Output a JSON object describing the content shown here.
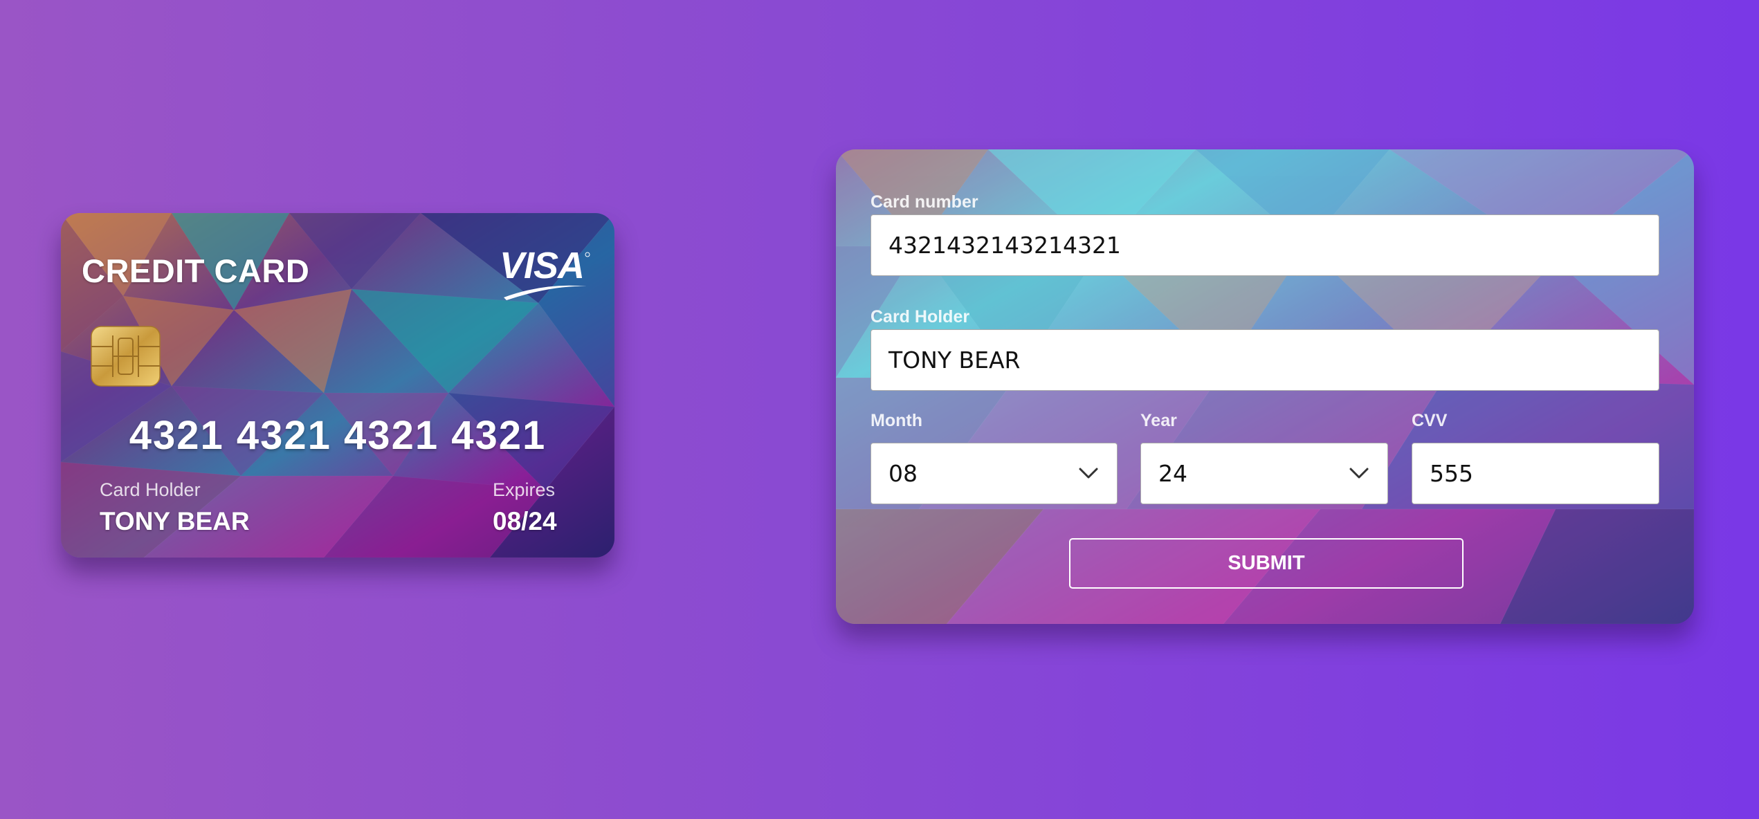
{
  "card": {
    "title": "CREDIT CARD",
    "brand": "VISA",
    "number": "4321 4321 4321 4321",
    "holder_label": "Card Holder",
    "holder_value": "TONY BEAR",
    "expires_label": "Expires",
    "expires_value": "08/24"
  },
  "form": {
    "card_number_label": "Card number",
    "card_number_value": "4321432143214321",
    "card_holder_label": "Card Holder",
    "card_holder_value": "TONY BEAR",
    "month_label": "Month",
    "month_value": "08",
    "year_label": "Year",
    "year_value": "24",
    "cvv_label": "CVV",
    "cvv_value": "555",
    "submit_label": "SUBMIT"
  },
  "colors": {
    "background_left": "#9a55c6",
    "background_right": "#7a38e6",
    "field_background": "#ffffff",
    "button_border": "#ffffff"
  },
  "icons": [
    "chip-icon",
    "visa-logo",
    "chevron-down-icon"
  ]
}
